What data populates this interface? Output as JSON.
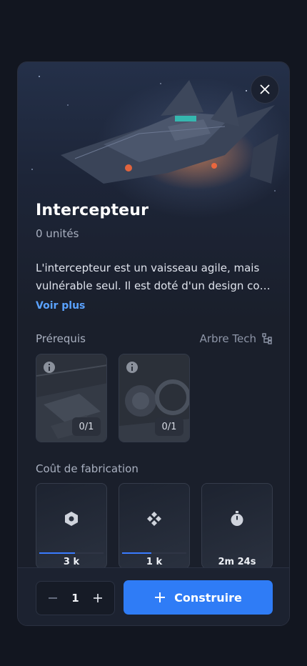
{
  "unit": {
    "name": "Intercepteur",
    "count_label": "0 unités",
    "description_line1": "L'intercepteur est un vaisseau agile, mais",
    "description_line2": "vulnérable seul. Il est doté d'un design co…",
    "see_more": "Voir plus"
  },
  "prerequisites": {
    "label": "Prérequis",
    "tech_tree_label": "Arbre Tech",
    "items": [
      {
        "count": "0/1"
      },
      {
        "count": "0/1"
      }
    ]
  },
  "cost": {
    "label": "Coût de fabrication",
    "items": [
      {
        "icon": "hexagon-resource-icon",
        "value": "3 k",
        "progress": 0.55
      },
      {
        "icon": "crystal-resource-icon",
        "value": "1 k",
        "progress": 0.46
      },
      {
        "icon": "timer-icon",
        "value": "2m 24s",
        "progress": 0
      }
    ]
  },
  "footer": {
    "quantity": "1",
    "build_label": "Construire"
  },
  "colors": {
    "accent": "#2f7cf6",
    "link": "#5aa2ff",
    "panel": "#1a1f2b",
    "background": "#121620"
  }
}
